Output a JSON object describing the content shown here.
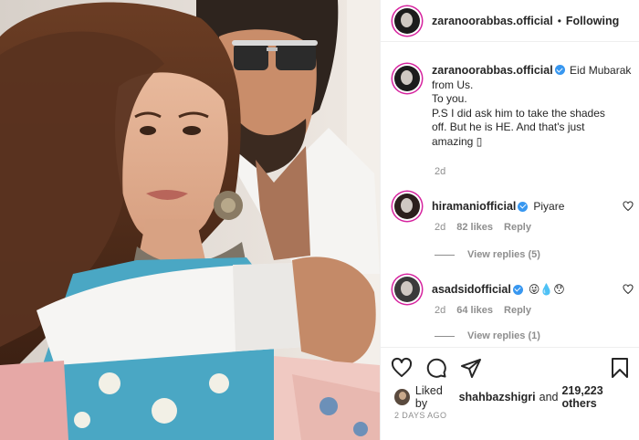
{
  "header": {
    "username": "zaranoorabbas.official",
    "separator": "•",
    "follow_label": "Following"
  },
  "caption": {
    "username": "zaranoorabbas.official",
    "lines": [
      "Eid Mubarak",
      "from Us.",
      "To you.",
      "P.S I did ask him to take the shades",
      "off. But he is HE. And that's just",
      "amazing ▯"
    ],
    "time": "2d"
  },
  "comments": [
    {
      "username": "hiramaniofficial",
      "text": "Piyare",
      "time": "2d",
      "likes": "82 likes",
      "reply_label": "Reply",
      "view_replies": "View replies (5)"
    },
    {
      "username": "asadsidofficial",
      "text": "😜💧😯",
      "time": "2d",
      "likes": "64 likes",
      "reply_label": "Reply",
      "view_replies": "View replies (1)"
    }
  ],
  "likes_bar": {
    "prefix": "Liked by",
    "user": "shahbazshigri",
    "middle": "and",
    "count": "219,223 others"
  },
  "post_date": "2 DAYS AGO",
  "icons": {
    "like": "heart-icon",
    "comment": "comment-icon",
    "share": "share-icon",
    "save": "bookmark-icon",
    "verified": "verified-badge-icon"
  },
  "colors": {
    "text": "#262626",
    "secondary": "#8e8e8e",
    "verified": "#3897f0",
    "border": "#efefef"
  }
}
